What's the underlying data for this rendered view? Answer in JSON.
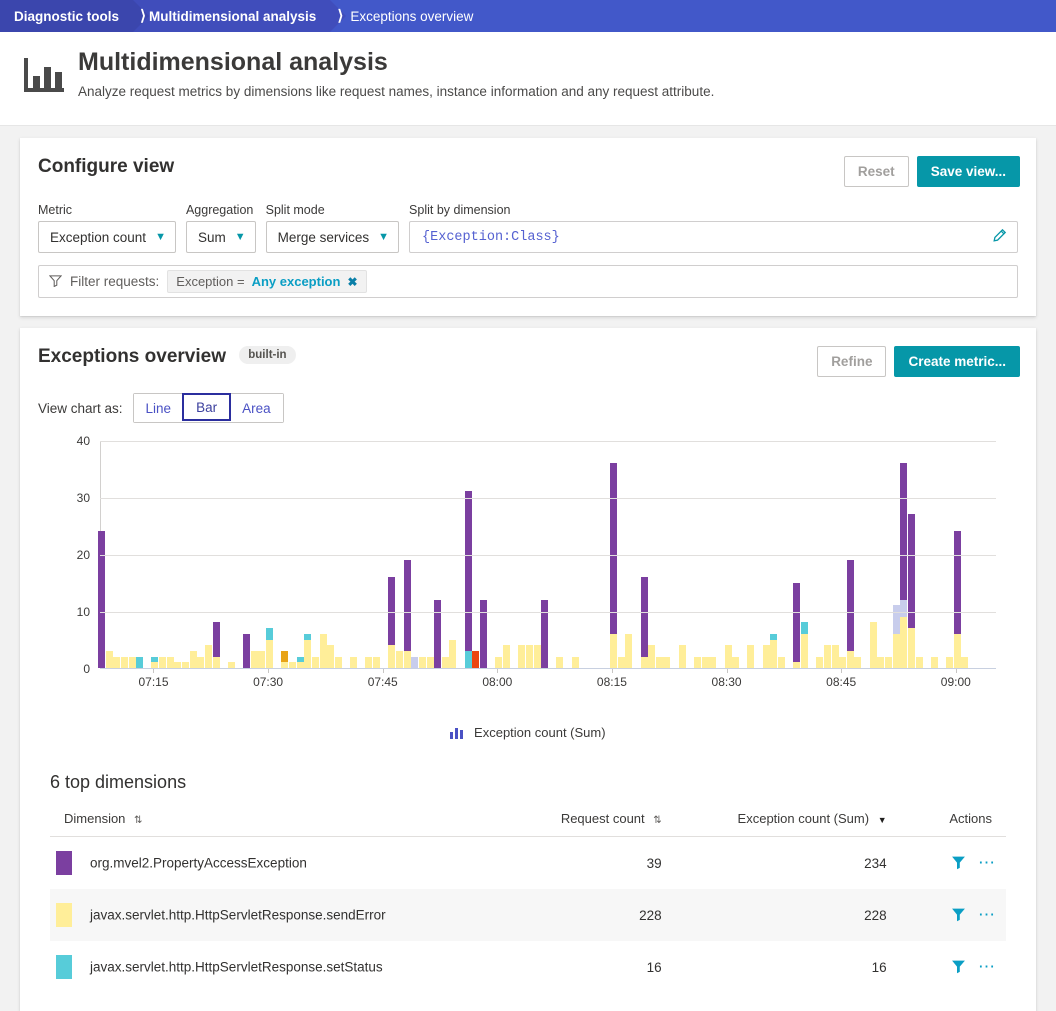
{
  "breadcrumb": {
    "items": [
      {
        "label": "Diagnostic tools"
      },
      {
        "label": "Multidimensional analysis"
      },
      {
        "label": "Exceptions overview"
      }
    ]
  },
  "header": {
    "title": "Multidimensional analysis",
    "subtitle": "Analyze request metrics by dimensions like request names, instance information and any request attribute.",
    "icon": "bar-chart-icon"
  },
  "configure": {
    "title": "Configure view",
    "reset_label": "Reset",
    "save_label": "Save view...",
    "metric_label": "Metric",
    "metric_value": "Exception count",
    "aggregation_label": "Aggregation",
    "aggregation_value": "Sum",
    "splitmode_label": "Split mode",
    "splitmode_value": "Merge services",
    "splitdim_label": "Split by dimension",
    "splitdim_value": "{Exception:Class}",
    "edit_icon": "pencil-icon",
    "filter_icon": "filter-icon",
    "filter_label": "Filter requests:",
    "filter_chip_key": "Exception =",
    "filter_chip_value": "Any exception",
    "filter_chip_remove": "✖"
  },
  "chart_panel": {
    "title": "Exceptions overview",
    "badge": "built-in",
    "refine_label": "Refine",
    "create_metric_label": "Create metric...",
    "view_as_label": "View chart as:",
    "chart_types": [
      {
        "label": "Line",
        "selected": false
      },
      {
        "label": "Bar",
        "selected": true
      },
      {
        "label": "Area",
        "selected": false
      }
    ]
  },
  "chart_data": {
    "type": "bar",
    "stacked": true,
    "title": "Exceptions overview",
    "xlabel": "",
    "ylabel": "",
    "ylim": [
      0,
      40
    ],
    "yticks": [
      0,
      10,
      20,
      30,
      40
    ],
    "grid": true,
    "legend_position": "bottom",
    "legend": [
      "Exception count (Sum)"
    ],
    "legend_icon": "mini-bar-chart-icon",
    "x_axis_type": "time",
    "x_range": [
      "07:08",
      "09:05"
    ],
    "xticks": [
      "07:15",
      "07:30",
      "07:45",
      "08:00",
      "08:15",
      "08:30",
      "08:45",
      "09:00"
    ],
    "series_colors": {
      "org.mvel2.PropertyAccessException": "#7b3fa0",
      "javax.servlet.http.HttpServletResponse.sendError": "#ffee99",
      "javax.servlet.http.HttpServletResponse.setStatus": "#57ccd9",
      "series_d": "#c8cdec",
      "series_e": "#e8a317",
      "series_f": "#eb4511"
    },
    "bars": [
      {
        "t": "07:08",
        "purple": 24,
        "yellow": 0,
        "cyan": 0,
        "lav": 0,
        "orange": 0,
        "red": 0
      },
      {
        "t": "07:09",
        "purple": 0,
        "yellow": 3,
        "cyan": 0,
        "lav": 0,
        "orange": 0,
        "red": 0
      },
      {
        "t": "07:10",
        "purple": 0,
        "yellow": 2,
        "cyan": 0,
        "lav": 0,
        "orange": 0,
        "red": 0
      },
      {
        "t": "07:11",
        "purple": 0,
        "yellow": 2,
        "cyan": 0,
        "lav": 0,
        "orange": 0,
        "red": 0
      },
      {
        "t": "07:12",
        "purple": 0,
        "yellow": 2,
        "cyan": 0,
        "lav": 0,
        "orange": 0,
        "red": 0
      },
      {
        "t": "07:13",
        "purple": 0,
        "yellow": 0,
        "cyan": 2,
        "lav": 0,
        "orange": 0,
        "red": 0
      },
      {
        "t": "07:15",
        "purple": 0,
        "yellow": 1,
        "cyan": 1,
        "lav": 0,
        "orange": 0,
        "red": 0
      },
      {
        "t": "07:16",
        "purple": 0,
        "yellow": 2,
        "cyan": 0,
        "lav": 0,
        "orange": 0,
        "red": 0
      },
      {
        "t": "07:17",
        "purple": 0,
        "yellow": 2,
        "cyan": 0,
        "lav": 0,
        "orange": 0,
        "red": 0
      },
      {
        "t": "07:18",
        "purple": 0,
        "yellow": 1,
        "cyan": 0,
        "lav": 0,
        "orange": 0,
        "red": 0
      },
      {
        "t": "07:19",
        "purple": 0,
        "yellow": 1,
        "cyan": 0,
        "lav": 0,
        "orange": 0,
        "red": 0
      },
      {
        "t": "07:20",
        "purple": 0,
        "yellow": 3,
        "cyan": 0,
        "lav": 0,
        "orange": 0,
        "red": 0
      },
      {
        "t": "07:21",
        "purple": 0,
        "yellow": 2,
        "cyan": 0,
        "lav": 0,
        "orange": 0,
        "red": 0
      },
      {
        "t": "07:22",
        "purple": 0,
        "yellow": 4,
        "cyan": 0,
        "lav": 0,
        "orange": 0,
        "red": 0
      },
      {
        "t": "07:23",
        "purple": 6,
        "yellow": 2,
        "cyan": 0,
        "lav": 0,
        "orange": 0,
        "red": 0
      },
      {
        "t": "07:25",
        "purple": 0,
        "yellow": 1,
        "cyan": 0,
        "lav": 0,
        "orange": 0,
        "red": 0
      },
      {
        "t": "07:27",
        "purple": 6,
        "yellow": 0,
        "cyan": 0,
        "lav": 0,
        "orange": 0,
        "red": 0
      },
      {
        "t": "07:28",
        "purple": 0,
        "yellow": 3,
        "cyan": 0,
        "lav": 0,
        "orange": 0,
        "red": 0
      },
      {
        "t": "07:29",
        "purple": 0,
        "yellow": 3,
        "cyan": 0,
        "lav": 0,
        "orange": 0,
        "red": 0
      },
      {
        "t": "07:30",
        "purple": 0,
        "yellow": 5,
        "cyan": 2,
        "lav": 0,
        "orange": 0,
        "red": 0
      },
      {
        "t": "07:32",
        "purple": 0,
        "yellow": 1,
        "cyan": 0,
        "lav": 0,
        "orange": 2,
        "red": 0
      },
      {
        "t": "07:33",
        "purple": 0,
        "yellow": 1,
        "cyan": 0,
        "lav": 0,
        "orange": 0,
        "red": 0
      },
      {
        "t": "07:34",
        "purple": 0,
        "yellow": 1,
        "cyan": 1,
        "lav": 0,
        "orange": 0,
        "red": 0
      },
      {
        "t": "07:35",
        "purple": 0,
        "yellow": 5,
        "cyan": 1,
        "lav": 0,
        "orange": 0,
        "red": 0
      },
      {
        "t": "07:36",
        "purple": 0,
        "yellow": 2,
        "cyan": 0,
        "lav": 0,
        "orange": 0,
        "red": 0
      },
      {
        "t": "07:37",
        "purple": 0,
        "yellow": 6,
        "cyan": 0,
        "lav": 0,
        "orange": 0,
        "red": 0
      },
      {
        "t": "07:38",
        "purple": 0,
        "yellow": 4,
        "cyan": 0,
        "lav": 0,
        "orange": 0,
        "red": 0
      },
      {
        "t": "07:39",
        "purple": 0,
        "yellow": 2,
        "cyan": 0,
        "lav": 0,
        "orange": 0,
        "red": 0
      },
      {
        "t": "07:41",
        "purple": 0,
        "yellow": 2,
        "cyan": 0,
        "lav": 0,
        "orange": 0,
        "red": 0
      },
      {
        "t": "07:43",
        "purple": 0,
        "yellow": 2,
        "cyan": 0,
        "lav": 0,
        "orange": 0,
        "red": 0
      },
      {
        "t": "07:44",
        "purple": 0,
        "yellow": 2,
        "cyan": 0,
        "lav": 0,
        "orange": 0,
        "red": 0
      },
      {
        "t": "07:46",
        "purple": 12,
        "yellow": 4,
        "cyan": 0,
        "lav": 0,
        "orange": 0,
        "red": 0
      },
      {
        "t": "07:47",
        "purple": 0,
        "yellow": 3,
        "cyan": 0,
        "lav": 0,
        "orange": 0,
        "red": 0
      },
      {
        "t": "07:48",
        "purple": 16,
        "yellow": 3,
        "cyan": 0,
        "lav": 0,
        "orange": 0,
        "red": 0
      },
      {
        "t": "07:49",
        "purple": 0,
        "yellow": 0,
        "cyan": 0,
        "lav": 2,
        "orange": 0,
        "red": 0
      },
      {
        "t": "07:50",
        "purple": 0,
        "yellow": 2,
        "cyan": 0,
        "lav": 0,
        "orange": 0,
        "red": 0
      },
      {
        "t": "07:51",
        "purple": 0,
        "yellow": 2,
        "cyan": 0,
        "lav": 0,
        "orange": 0,
        "red": 0
      },
      {
        "t": "07:52",
        "purple": 12,
        "yellow": 0,
        "cyan": 0,
        "lav": 0,
        "orange": 0,
        "red": 0
      },
      {
        "t": "07:53",
        "purple": 0,
        "yellow": 2,
        "cyan": 0,
        "lav": 0,
        "orange": 0,
        "red": 0
      },
      {
        "t": "07:54",
        "purple": 0,
        "yellow": 5,
        "cyan": 0,
        "lav": 0,
        "orange": 0,
        "red": 0
      },
      {
        "t": "07:56",
        "purple": 28,
        "yellow": 0,
        "cyan": 3,
        "lav": 0,
        "orange": 0,
        "red": 0
      },
      {
        "t": "07:57",
        "purple": 0,
        "yellow": 0,
        "cyan": 0,
        "lav": 0,
        "orange": 0,
        "red": 3
      },
      {
        "t": "07:58",
        "purple": 12,
        "yellow": 0,
        "cyan": 0,
        "lav": 0,
        "orange": 0,
        "red": 0
      },
      {
        "t": "08:00",
        "purple": 0,
        "yellow": 2,
        "cyan": 0,
        "lav": 0,
        "orange": 0,
        "red": 0
      },
      {
        "t": "08:01",
        "purple": 0,
        "yellow": 4,
        "cyan": 0,
        "lav": 0,
        "orange": 0,
        "red": 0
      },
      {
        "t": "08:03",
        "purple": 0,
        "yellow": 4,
        "cyan": 0,
        "lav": 0,
        "orange": 0,
        "red": 0
      },
      {
        "t": "08:04",
        "purple": 0,
        "yellow": 4,
        "cyan": 0,
        "lav": 0,
        "orange": 0,
        "red": 0
      },
      {
        "t": "08:05",
        "purple": 0,
        "yellow": 4,
        "cyan": 0,
        "lav": 0,
        "orange": 0,
        "red": 0
      },
      {
        "t": "08:06",
        "purple": 12,
        "yellow": 0,
        "cyan": 0,
        "lav": 0,
        "orange": 0,
        "red": 0
      },
      {
        "t": "08:08",
        "purple": 0,
        "yellow": 2,
        "cyan": 0,
        "lav": 0,
        "orange": 0,
        "red": 0
      },
      {
        "t": "08:10",
        "purple": 0,
        "yellow": 2,
        "cyan": 0,
        "lav": 0,
        "orange": 0,
        "red": 0
      },
      {
        "t": "08:15",
        "purple": 30,
        "yellow": 6,
        "cyan": 0,
        "lav": 0,
        "orange": 0,
        "red": 0
      },
      {
        "t": "08:16",
        "purple": 0,
        "yellow": 2,
        "cyan": 0,
        "lav": 0,
        "orange": 0,
        "red": 0
      },
      {
        "t": "08:17",
        "purple": 0,
        "yellow": 6,
        "cyan": 0,
        "lav": 0,
        "orange": 0,
        "red": 0
      },
      {
        "t": "08:19",
        "purple": 14,
        "yellow": 2,
        "cyan": 0,
        "lav": 0,
        "orange": 0,
        "red": 0
      },
      {
        "t": "08:20",
        "purple": 0,
        "yellow": 4,
        "cyan": 0,
        "lav": 0,
        "orange": 0,
        "red": 0
      },
      {
        "t": "08:21",
        "purple": 0,
        "yellow": 2,
        "cyan": 0,
        "lav": 0,
        "orange": 0,
        "red": 0
      },
      {
        "t": "08:22",
        "purple": 0,
        "yellow": 2,
        "cyan": 0,
        "lav": 0,
        "orange": 0,
        "red": 0
      },
      {
        "t": "08:24",
        "purple": 0,
        "yellow": 4,
        "cyan": 0,
        "lav": 0,
        "orange": 0,
        "red": 0
      },
      {
        "t": "08:26",
        "purple": 0,
        "yellow": 2,
        "cyan": 0,
        "lav": 0,
        "orange": 0,
        "red": 0
      },
      {
        "t": "08:27",
        "purple": 0,
        "yellow": 2,
        "cyan": 0,
        "lav": 0,
        "orange": 0,
        "red": 0
      },
      {
        "t": "08:28",
        "purple": 0,
        "yellow": 2,
        "cyan": 0,
        "lav": 0,
        "orange": 0,
        "red": 0
      },
      {
        "t": "08:30",
        "purple": 0,
        "yellow": 4,
        "cyan": 0,
        "lav": 0,
        "orange": 0,
        "red": 0
      },
      {
        "t": "08:31",
        "purple": 0,
        "yellow": 2,
        "cyan": 0,
        "lav": 0,
        "orange": 0,
        "red": 0
      },
      {
        "t": "08:33",
        "purple": 0,
        "yellow": 4,
        "cyan": 0,
        "lav": 0,
        "orange": 0,
        "red": 0
      },
      {
        "t": "08:35",
        "purple": 0,
        "yellow": 4,
        "cyan": 0,
        "lav": 0,
        "orange": 0,
        "red": 0
      },
      {
        "t": "08:36",
        "purple": 0,
        "yellow": 5,
        "cyan": 1,
        "lav": 0,
        "orange": 0,
        "red": 0
      },
      {
        "t": "08:37",
        "purple": 0,
        "yellow": 2,
        "cyan": 0,
        "lav": 0,
        "orange": 0,
        "red": 0
      },
      {
        "t": "08:39",
        "purple": 14,
        "yellow": 1,
        "cyan": 0,
        "lav": 0,
        "orange": 0,
        "red": 0
      },
      {
        "t": "08:40",
        "purple": 0,
        "yellow": 6,
        "cyan": 2,
        "lav": 0,
        "orange": 0,
        "red": 0
      },
      {
        "t": "08:42",
        "purple": 0,
        "yellow": 2,
        "cyan": 0,
        "lav": 0,
        "orange": 0,
        "red": 0
      },
      {
        "t": "08:43",
        "purple": 0,
        "yellow": 4,
        "cyan": 0,
        "lav": 0,
        "orange": 0,
        "red": 0
      },
      {
        "t": "08:44",
        "purple": 0,
        "yellow": 4,
        "cyan": 0,
        "lav": 0,
        "orange": 0,
        "red": 0
      },
      {
        "t": "08:45",
        "purple": 0,
        "yellow": 2,
        "cyan": 0,
        "lav": 0,
        "orange": 0,
        "red": 0
      },
      {
        "t": "08:46",
        "purple": 16,
        "yellow": 3,
        "cyan": 0,
        "lav": 0,
        "orange": 0,
        "red": 0
      },
      {
        "t": "08:47",
        "purple": 0,
        "yellow": 2,
        "cyan": 0,
        "lav": 0,
        "orange": 0,
        "red": 0
      },
      {
        "t": "08:49",
        "purple": 0,
        "yellow": 8,
        "cyan": 0,
        "lav": 0,
        "orange": 0,
        "red": 0
      },
      {
        "t": "08:50",
        "purple": 0,
        "yellow": 2,
        "cyan": 0,
        "lav": 0,
        "orange": 0,
        "red": 0
      },
      {
        "t": "08:51",
        "purple": 0,
        "yellow": 2,
        "cyan": 0,
        "lav": 0,
        "orange": 0,
        "red": 0
      },
      {
        "t": "08:52",
        "purple": 0,
        "yellow": 6,
        "cyan": 0,
        "lav": 5,
        "orange": 0,
        "red": 0
      },
      {
        "t": "08:53",
        "purple": 24,
        "yellow": 9,
        "cyan": 0,
        "lav": 3,
        "orange": 0,
        "red": 0
      },
      {
        "t": "08:54",
        "purple": 20,
        "yellow": 7,
        "cyan": 0,
        "lav": 0,
        "orange": 0,
        "red": 0
      },
      {
        "t": "08:55",
        "purple": 0,
        "yellow": 2,
        "cyan": 0,
        "lav": 0,
        "orange": 0,
        "red": 0
      },
      {
        "t": "08:57",
        "purple": 0,
        "yellow": 2,
        "cyan": 0,
        "lav": 0,
        "orange": 0,
        "red": 0
      },
      {
        "t": "08:59",
        "purple": 0,
        "yellow": 2,
        "cyan": 0,
        "lav": 0,
        "orange": 0,
        "red": 0
      },
      {
        "t": "09:00",
        "purple": 18,
        "yellow": 6,
        "cyan": 0,
        "lav": 0,
        "orange": 0,
        "red": 0
      },
      {
        "t": "09:01",
        "purple": 0,
        "yellow": 2,
        "cyan": 0,
        "lav": 0,
        "orange": 0,
        "red": 0
      }
    ]
  },
  "table": {
    "title": "6 top dimensions",
    "columns": [
      {
        "label": "Dimension",
        "sort": "both"
      },
      {
        "label": "Request count",
        "sort": "both"
      },
      {
        "label": "Exception count (Sum)",
        "sort": "desc"
      },
      {
        "label": "Actions",
        "sort": "none"
      }
    ],
    "rows": [
      {
        "color": "#7b3fa0",
        "dimension": "org.mvel2.PropertyAccessException",
        "request_count": "39",
        "exception_count": "234",
        "filter_icon": "filter-icon",
        "more_icon": "more-actions-icon"
      },
      {
        "color": "#ffee99",
        "dimension": "javax.servlet.http.HttpServletResponse.sendError",
        "request_count": "228",
        "exception_count": "228",
        "filter_icon": "filter-icon",
        "more_icon": "more-actions-icon"
      },
      {
        "color": "#57ccd9",
        "dimension": "javax.servlet.http.HttpServletResponse.setStatus",
        "request_count": "16",
        "exception_count": "16",
        "filter_icon": "filter-icon",
        "more_icon": "more-actions-icon"
      }
    ]
  }
}
